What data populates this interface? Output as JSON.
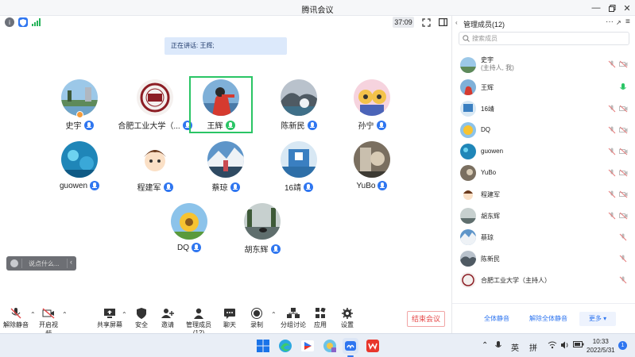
{
  "window": {
    "title": "腾讯会议"
  },
  "meeting": {
    "timer": "37:09",
    "speaking_label": "正在讲话: 王辉;",
    "chat_placeholder": "说点什么...",
    "participants": [
      {
        "name": "史宇"
      },
      {
        "name": "合肥工业大学（..."
      },
      {
        "name": "王辉"
      },
      {
        "name": "陈新民"
      },
      {
        "name": "孙宁"
      },
      {
        "name": "guowen"
      },
      {
        "name": "程建军"
      },
      {
        "name": "蔡琼"
      },
      {
        "name": "16靖"
      },
      {
        "name": "YuBo"
      },
      {
        "name": "DQ"
      },
      {
        "name": "胡东辉"
      }
    ]
  },
  "toolbar": {
    "unmute": "解除静音",
    "start_video": "开启视频",
    "share_screen": "共享屏幕",
    "security": "安全",
    "invite": "邀请",
    "manage_members": "管理成员(12)",
    "chat": "聊天",
    "record": "录制",
    "breakout": "分组讨论",
    "apps": "应用",
    "settings": "设置",
    "end_meeting": "结束会议"
  },
  "panel": {
    "title": "管理成员(12)",
    "search_placeholder": "搜索成员",
    "members": [
      {
        "name": "史宇",
        "sub": "(主持人, 我)"
      },
      {
        "name": "王辉"
      },
      {
        "name": "16靖"
      },
      {
        "name": "DQ"
      },
      {
        "name": "guowen"
      },
      {
        "name": "YuBo"
      },
      {
        "name": "程建军"
      },
      {
        "name": "胡东辉"
      },
      {
        "name": "蔡琼"
      },
      {
        "name": "陈新民"
      },
      {
        "name": "合肥工业大学（主持人）"
      }
    ],
    "mute_all": "全体静音",
    "unmute_all": "解除全体静音",
    "more": "更多"
  },
  "taskbar": {
    "ime_lang": "英",
    "ime_mode": "拼",
    "time": "10:33",
    "date": "2022/5/31",
    "notification_count": "1"
  },
  "colors": {
    "accent": "#2f76f0",
    "active_speaker_border": "#2ac565",
    "speaking_banner": "#dce9fb",
    "end_button": "#e54646"
  }
}
